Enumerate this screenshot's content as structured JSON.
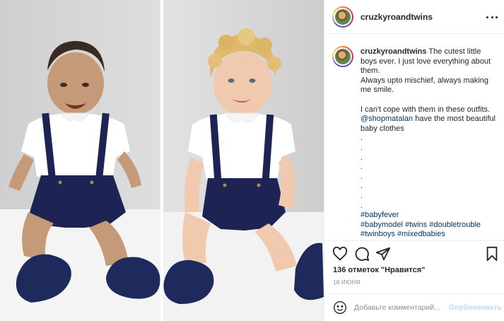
{
  "photo": {
    "left_background": "#d9d9d9",
    "right_background": "#dcdcdc"
  },
  "header": {
    "username": "cruzkyroandtwins",
    "more_icon": "more-horizontal-icon"
  },
  "caption": {
    "username": "cruzkyroandtwins",
    "text_1": " The cutest little boys ever. I just love everything about them.\nAlways upto mischief, always making me smile.\n\nI can't cope with them in these outfits. ",
    "mention": "@shopmatalan",
    "text_2": " have the most beautiful baby clothes\n.\n.\n.\n.\n.\n.\n.\n.\n",
    "hashtags": [
      "#babyfever",
      "#babymodel",
      "#twins",
      "#doubletrouble",
      "#twinboys",
      "#mixedbabies"
    ]
  },
  "actions": {
    "like_icon": "heart-icon",
    "comment_icon": "comment-icon",
    "share_icon": "paper-plane-icon",
    "save_icon": "bookmark-icon"
  },
  "likes_text": "136 отметок \"Нравится\"",
  "date_text": "18 июня",
  "comment": {
    "emoji_icon": "smile-icon",
    "placeholder": "Добавьте комментарий...",
    "publish_label": "Опубликовать"
  },
  "colors": {
    "link": "#00376b",
    "publish_disabled": "#b2dffc",
    "muted": "#8e8e8e"
  }
}
